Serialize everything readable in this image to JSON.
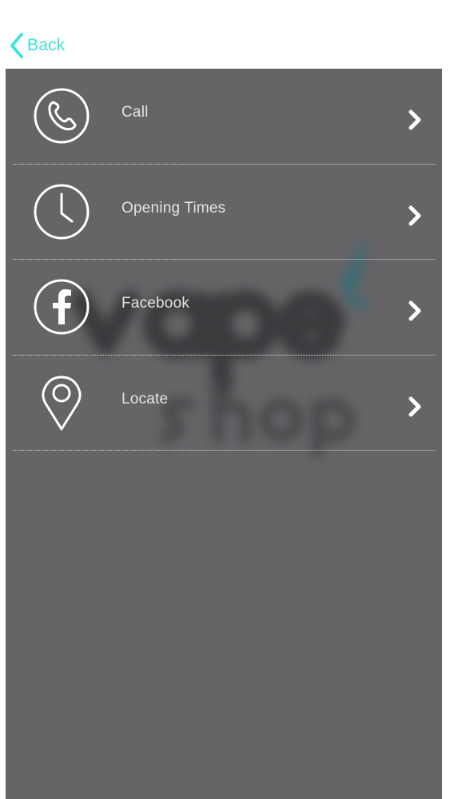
{
  "nav": {
    "back_label": "Back"
  },
  "menu": {
    "items": [
      {
        "label": "Call",
        "icon": "phone-icon"
      },
      {
        "label": "Opening Times",
        "icon": "clock-icon"
      },
      {
        "label": "Facebook",
        "icon": "facebook-icon"
      },
      {
        "label": "Locate",
        "icon": "location-pin-icon"
      }
    ]
  },
  "background": {
    "logo": "vape shop logo (blurred)"
  },
  "colors": {
    "accent": "#3fe3dc",
    "panel": "#666467",
    "label": "#e3e3e3",
    "icon": "#ffffff",
    "divider": "#d8d8d8"
  }
}
